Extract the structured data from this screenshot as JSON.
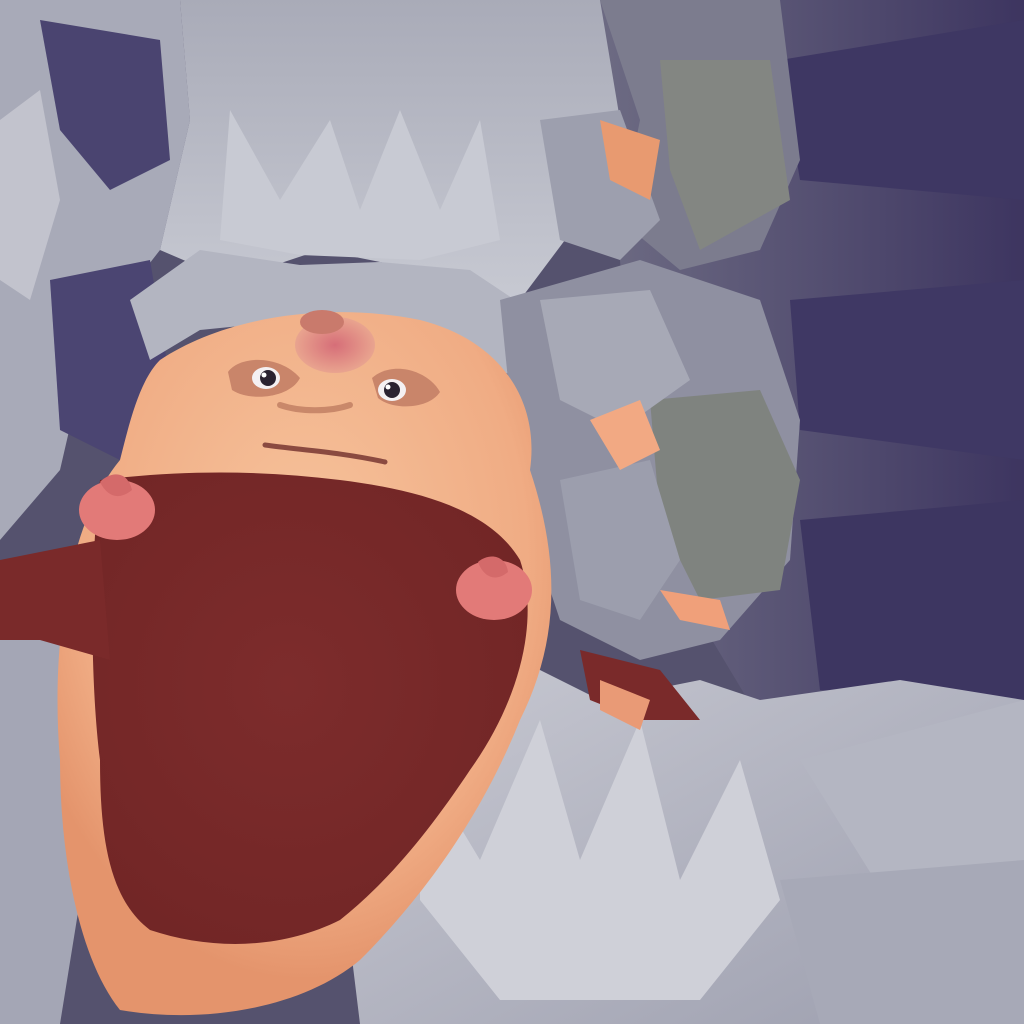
{
  "scene": {
    "kind": "texture-atlas-render",
    "subject": "character-head-upside-down",
    "palette": {
      "background_purple": "#4a4666",
      "deep_purple": "#3d3560",
      "fur_light": "#b9bbc6",
      "fur_mid": "#9fa1b0",
      "fur_shadow": "#73738a",
      "fur_green_gray": "#7f837f",
      "skin": "#f3b28a",
      "skin_shadow": "#e39a72",
      "cheek_pink": "#d98080",
      "mouth_red": "#7b2b2b",
      "ear_pink": "#e07878",
      "nose_pink": "#d8898a",
      "eye_dark": "#2a2230",
      "eye_white": "#f4f0f2"
    },
    "layers": {
      "background": "scene-background",
      "fur_clusters": "fur-cluster",
      "face": "character-face",
      "mouth": "mouth-cavity",
      "eyes": "eye",
      "ears": "ear",
      "nose": "nose"
    }
  }
}
